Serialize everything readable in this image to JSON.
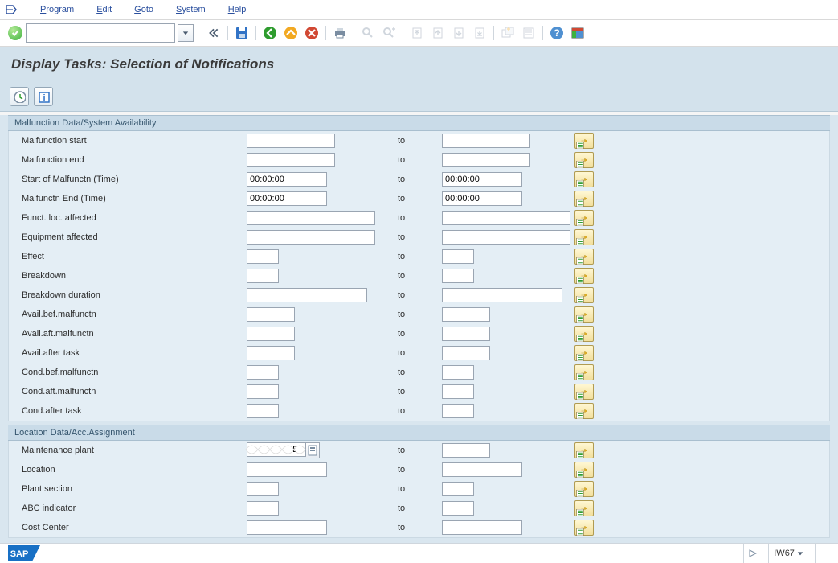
{
  "menu": {
    "program": "Program",
    "edit": "Edit",
    "goto": "Goto",
    "system": "System",
    "help": "Help"
  },
  "cmd_value": "",
  "title": "Display Tasks: Selection of Notifications",
  "groups": {
    "malfunction": {
      "header": "Malfunction Data/System Availability",
      "rows": {
        "malf_start": {
          "label": "Malfunction start",
          "from": "",
          "to_lbl": "to",
          "to": ""
        },
        "malf_end": {
          "label": "Malfunction end",
          "from": "",
          "to_lbl": "to",
          "to": ""
        },
        "start_time": {
          "label": "Start of Malfunctn (Time)",
          "from": "00:00:00",
          "to_lbl": "to",
          "to": "00:00:00"
        },
        "end_time": {
          "label": "Malfunctn End (Time)",
          "from": "00:00:00",
          "to_lbl": "to",
          "to": "00:00:00"
        },
        "funct_loc": {
          "label": "Funct. loc. affected",
          "from": "",
          "to_lbl": "to",
          "to": ""
        },
        "equip": {
          "label": "Equipment affected",
          "from": "",
          "to_lbl": "to",
          "to": ""
        },
        "effect": {
          "label": "Effect",
          "from": "",
          "to_lbl": "to",
          "to": ""
        },
        "breakdown": {
          "label": "Breakdown",
          "from": "",
          "to_lbl": "to",
          "to": ""
        },
        "bd_dur": {
          "label": "Breakdown duration",
          "from": "",
          "to_lbl": "to",
          "to": ""
        },
        "avail_bef": {
          "label": "Avail.bef.malfunctn",
          "from": "",
          "to_lbl": "to",
          "to": ""
        },
        "avail_aft": {
          "label": "Avail.aft.malfunctn",
          "from": "",
          "to_lbl": "to",
          "to": ""
        },
        "avail_task": {
          "label": "Avail.after task",
          "from": "",
          "to_lbl": "to",
          "to": ""
        },
        "cond_bef": {
          "label": "Cond.bef.malfunctn",
          "from": "",
          "to_lbl": "to",
          "to": ""
        },
        "cond_aft": {
          "label": "Cond.aft.malfunctn",
          "from": "",
          "to_lbl": "to",
          "to": ""
        },
        "cond_task": {
          "label": "Cond.after task",
          "from": "",
          "to_lbl": "to",
          "to": ""
        }
      }
    },
    "location": {
      "header": "Location Data/Acc.Assignment",
      "rows": {
        "maint_plant": {
          "label": "Maintenance plant",
          "from": "9E",
          "to_lbl": "to",
          "to": ""
        },
        "location": {
          "label": "Location",
          "from": "",
          "to_lbl": "to",
          "to": ""
        },
        "plant_section": {
          "label": "Plant section",
          "from": "",
          "to_lbl": "to",
          "to": ""
        },
        "abc": {
          "label": "ABC indicator",
          "from": "",
          "to_lbl": "to",
          "to": ""
        },
        "cost_center": {
          "label": "Cost Center",
          "from": "",
          "to_lbl": "to",
          "to": ""
        }
      }
    }
  },
  "status": {
    "tcode": "IW67"
  }
}
